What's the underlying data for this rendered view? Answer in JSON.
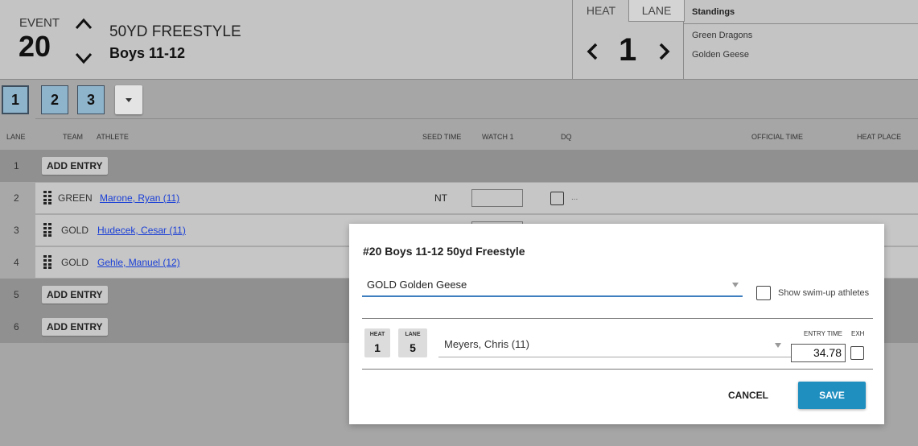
{
  "header": {
    "event_label": "EVENT",
    "event_number": "20",
    "event_title": "50YD FREESTYLE",
    "event_subtitle": "Boys 11-12",
    "heat_tab": "HEAT",
    "lane_tab": "LANE",
    "heat_number": "1"
  },
  "standings": {
    "title": "Standings",
    "items": [
      "Green Dragons",
      "Golden Geese"
    ]
  },
  "heat_buttons": [
    "1",
    "2",
    "3"
  ],
  "columns": {
    "lane": "LANE",
    "team": "TEAM",
    "athlete": "ATHLETE",
    "seed_time": "SEED TIME",
    "watch1": "WATCH 1",
    "dq": "DQ",
    "official_time": "OFFICIAL TIME",
    "heat_place": "HEAT PLACE"
  },
  "rows": [
    {
      "lane": "1",
      "add_entry": "ADD ENTRY"
    },
    {
      "lane": "2",
      "team": "GREEN",
      "athlete": "Marone, Ryan (11)",
      "seed": "NT",
      "dq_more": "..."
    },
    {
      "lane": "3",
      "team": "GOLD",
      "athlete": "Hudecek, Cesar (11)"
    },
    {
      "lane": "4",
      "team": "GOLD",
      "athlete": "Gehle, Manuel (12)"
    },
    {
      "lane": "5",
      "add_entry": "ADD ENTRY"
    },
    {
      "lane": "6",
      "add_entry": "ADD ENTRY"
    }
  ],
  "modal": {
    "title": "#20 Boys 11-12 50yd Freestyle",
    "team_value": "GOLD Golden Geese",
    "show_swimup_label": "Show swim-up athletes",
    "heat_label": "HEAT",
    "heat_value": "1",
    "lane_label": "LANE",
    "lane_value": "5",
    "athlete_value": "Meyers, Chris (11)",
    "entry_time_label": "ENTRY TIME",
    "exh_label": "EXH",
    "entry_time_value": "34.78",
    "cancel_label": "CANCEL",
    "save_label": "SAVE"
  },
  "colors": {
    "accent": "#1f8fc0",
    "heat_button": "#8eb4cc",
    "link": "#1a3fd6"
  }
}
